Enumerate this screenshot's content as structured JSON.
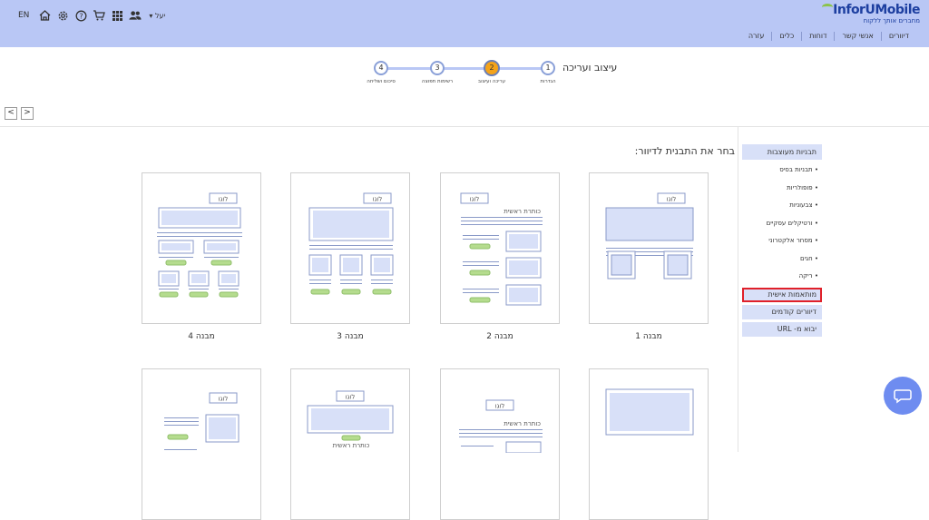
{
  "header": {
    "lang": "EN",
    "user": "יעל",
    "icons": [
      "home-icon",
      "gear-icon",
      "help-icon",
      "cart-icon",
      "apps-grid-icon",
      "users-icon"
    ],
    "logo_main": "InforUMobile",
    "logo_tagline": "מחברים אותך ללקוח",
    "nav": [
      "דיוורים",
      "אנשי קשר",
      "דוחות",
      "כלים",
      "עזרה"
    ]
  },
  "wizard": {
    "title": "עיצוב ועריכה",
    "steps": [
      {
        "num": "1",
        "label": "הגדרות"
      },
      {
        "num": "2",
        "label": "עריכה ועיצוב"
      },
      {
        "num": "3",
        "label": "רשימות תפוצה"
      },
      {
        "num": "4",
        "label": "סיכום ושליחה"
      }
    ],
    "active_step": 2
  },
  "pager": {
    "prev": "<",
    "next": ">"
  },
  "sidebar": {
    "heading": "תבניות מעוצבות",
    "items": [
      "תבניות בסיס",
      "פופולריות",
      "צבעוניות",
      "ורטיקלים עסקיים",
      "מסחר אלקטרוני",
      "חגים",
      "ריקה"
    ],
    "highlighted": "מותאמות אישית",
    "prev_mailings": "דיוורים קודמים",
    "import_url": "יבוא מ- URL"
  },
  "main": {
    "title": "בחר את התבנית לדיוור:",
    "template_labels": [
      "מבנה 1",
      "מבנה 2",
      "מבנה 3",
      "מבנה 4"
    ],
    "logo_text": "לוגו",
    "headline_text": "כותרת ראשית"
  },
  "colors": {
    "header_bg": "#b9c7f5",
    "block_fill": "#d8e0f8",
    "block_stroke": "#8a9ac8",
    "button_green": "#b5dc8e",
    "active_step": "#f4a31a",
    "highlight_border": "#e0202a",
    "chat_bubble": "#6e8cf0"
  }
}
